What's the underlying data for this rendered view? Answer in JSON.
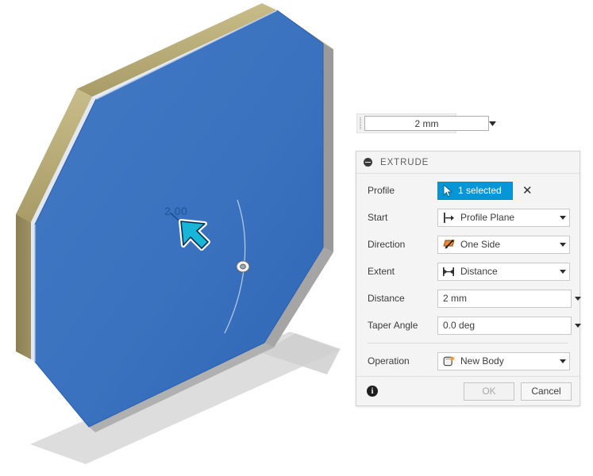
{
  "viewport": {
    "name": "3d-viewport",
    "dimension_label": "2.00",
    "cursor_icon": "arrow-cursor-icon",
    "model": {
      "face_color": "#3a72bf",
      "side_color": "#94875a",
      "edge_color": "#8d8d8d",
      "shadow_color": "#d6d6d6",
      "shape": "octagonal-plate"
    },
    "manipulator_icon": "extrude-drag-handle-icon"
  },
  "value_box": {
    "name": "floating-distance-input",
    "value": "2 mm",
    "placeholder": "2 mm",
    "dropdown_icon": "chevron-down-icon"
  },
  "dialog": {
    "title": "EXTRUDE",
    "collapse_icon": "collapse-minus-icon",
    "rows": {
      "profile": {
        "label": "Profile",
        "chip_text": "1 selected",
        "chip_icon": "selection-cursor-icon",
        "clear_label": "✕",
        "accent": "#0696d7"
      },
      "start": {
        "label": "Start",
        "value": "Profile Plane",
        "icon": "profile-plane-icon"
      },
      "direction": {
        "label": "Direction",
        "value": "One Side",
        "icon": "one-side-icon"
      },
      "extent": {
        "label": "Extent",
        "value": "Distance",
        "icon": "distance-extent-icon"
      },
      "distance": {
        "label": "Distance",
        "value": "2 mm",
        "placeholder": "2 mm",
        "dropdown_icon": "chevron-down-icon"
      },
      "taper_angle": {
        "label": "Taper Angle",
        "value": "0.0 deg",
        "placeholder": "0.0 deg",
        "dropdown_icon": "chevron-down-icon"
      },
      "operation": {
        "label": "Operation",
        "value": "New Body",
        "icon": "new-body-icon"
      }
    },
    "footer": {
      "info_icon": "info-icon",
      "info_glyph": "i",
      "ok_label": "OK",
      "cancel_label": "Cancel",
      "ok_enabled": false
    }
  }
}
